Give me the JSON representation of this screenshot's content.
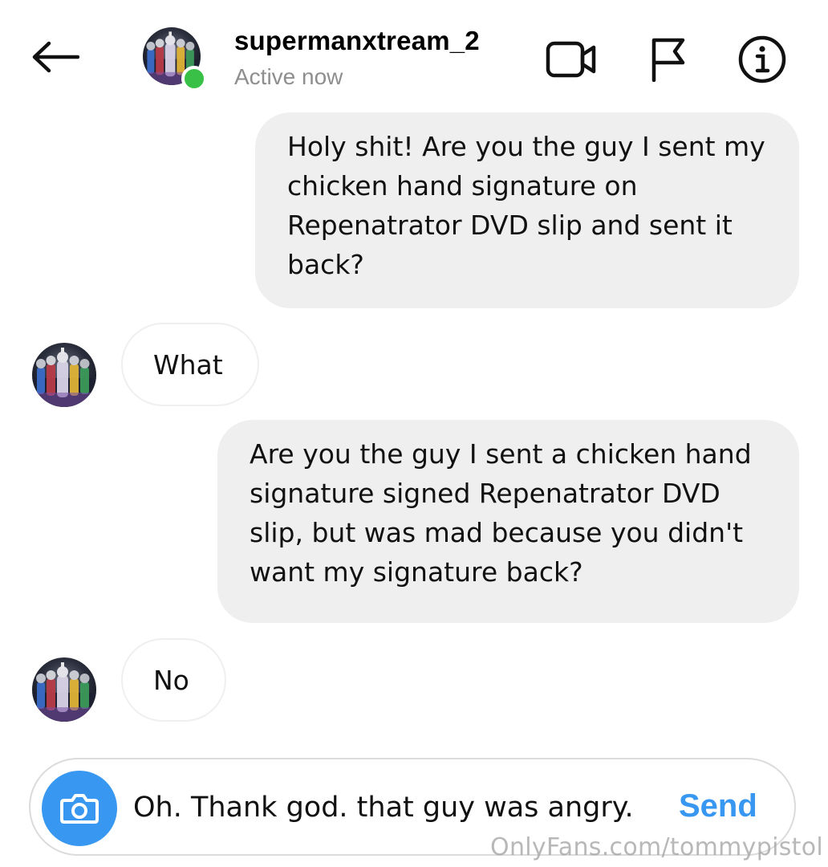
{
  "header": {
    "username": "supermanxtream_2",
    "status": "Active now",
    "icons": {
      "back": "arrow-left-icon",
      "video": "video-camera-icon",
      "flag": "flag-icon",
      "info": "info-icon"
    },
    "online_color": "#38c146"
  },
  "messages": [
    {
      "direction": "outgoing",
      "text": "Holy shit! Are you the guy I sent my chicken hand signature on Repenatrator DVD slip and sent it back?"
    },
    {
      "direction": "incoming",
      "text": "What"
    },
    {
      "direction": "outgoing",
      "text": "Are you the guy I sent a chicken hand signature signed Repenatrator DVD slip, but was mad because you didn't want my signature back?"
    },
    {
      "direction": "incoming",
      "text": "No"
    }
  ],
  "composer": {
    "value": "Oh. Thank god. that guy was angry.",
    "send_label": "Send",
    "camera_icon": "camera-icon",
    "accent_color": "#3897f0"
  },
  "watermark": "OnlyFans.com/tommypistol"
}
